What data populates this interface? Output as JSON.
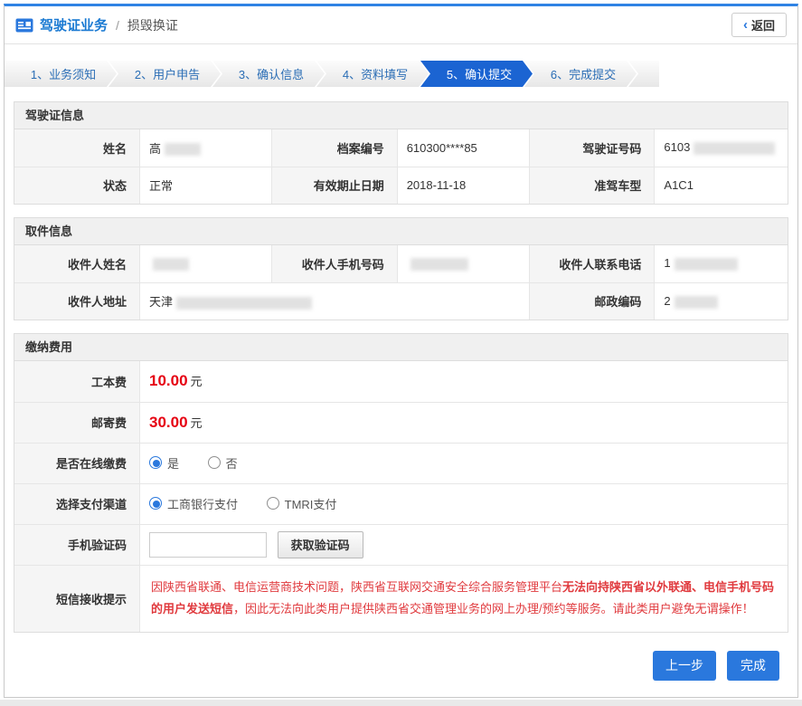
{
  "header": {
    "title": "驾驶证业务",
    "divider": "/",
    "subtitle": "损毁换证",
    "back_chevron": "‹",
    "back_label": "返回"
  },
  "steps": [
    {
      "label": "1、业务须知"
    },
    {
      "label": "2、用户申告"
    },
    {
      "label": "3、确认信息"
    },
    {
      "label": "4、资料填写"
    },
    {
      "label": "5、确认提交"
    },
    {
      "label": "6、完成提交"
    }
  ],
  "license": {
    "title": "驾驶证信息",
    "name_label": "姓名",
    "name_value": "高",
    "file_label": "档案编号",
    "file_value": "610300****85",
    "number_label": "驾驶证号码",
    "number_value": "6103",
    "status_label": "状态",
    "status_value": "正常",
    "expiry_label": "有效期止日期",
    "expiry_value": "2018-11-18",
    "class_label": "准驾车型",
    "class_value": "A1C1"
  },
  "pickup": {
    "title": "取件信息",
    "recipient_label": "收件人姓名",
    "mobile_label": "收件人手机号码",
    "phone_label": "收件人联系电话",
    "phone_value": "1",
    "address_label": "收件人地址",
    "address_value": "天津",
    "zip_label": "邮政编码",
    "zip_value": "2"
  },
  "payment": {
    "title": "缴纳费用",
    "fee1_label": "工本费",
    "fee1_amount": "10.00",
    "fee1_unit": "元",
    "fee2_label": "邮寄费",
    "fee2_amount": "30.00",
    "fee2_unit": "元",
    "online_label": "是否在线缴费",
    "online_yes": "是",
    "online_no": "否",
    "channel_label": "选择支付渠道",
    "channel_icbc": "工商银行支付",
    "channel_tmri": "TMRI支付",
    "captcha_label": "手机验证码",
    "captcha_button": "获取验证码",
    "sms_label": "短信接收提示",
    "sms_part1": "因陕西省联通、电信运营商技术问题，陕西省互联网交通安全综合服务管理平台",
    "sms_part2": "无法向持陕西省以外联通、电信手机号码的用户发送短信",
    "sms_part3": "，因此无法向此类用户提供陕西省交通管理业务的网上办理/预约等服务。请此类用户避免无谓操作！"
  },
  "footer": {
    "prev_label": "上一步",
    "finish_label": "完成"
  },
  "colors": {
    "accent_blue": "#2a78dd",
    "active_step_blue": "#1b64d2",
    "price_red": "#e60012",
    "notice_red": "#e03a3e"
  }
}
